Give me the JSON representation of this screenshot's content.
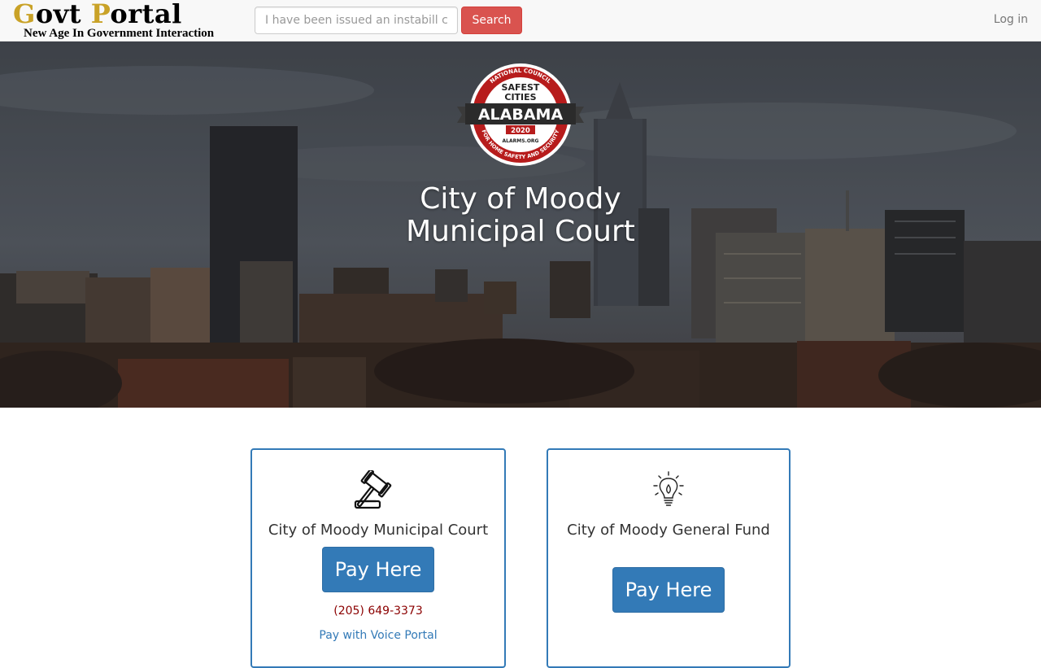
{
  "navbar": {
    "brand_title_first_initial": "G",
    "brand_title_first_rest": "ovt ",
    "brand_title_second_initial": "P",
    "brand_title_second_rest": "ortal",
    "brand_subtitle": "New Age In Government Interaction",
    "search_placeholder": "I have been issued an instabill code",
    "search_button": "Search",
    "login_label": "Log in"
  },
  "hero": {
    "badge": {
      "top_arc": "NATIONAL COUNCIL",
      "line1": "SAFEST",
      "line2": "CITIES",
      "banner": "ALABAMA",
      "year": "2020",
      "site": "ALARMS.ORG",
      "bottom_arc": "FOR HOME SAFETY AND SECURITY"
    },
    "title_line1": "City of Moody",
    "title_line2": "Municipal Court"
  },
  "cards": [
    {
      "icon": "gavel-icon",
      "title": "City of Moody Municipal Court",
      "button": "Pay Here",
      "phone": "(205) 649-3373",
      "voice_link": "Pay with Voice Portal"
    },
    {
      "icon": "lightbulb-icon",
      "title": "City of Moody General Fund",
      "button": "Pay Here"
    }
  ],
  "colors": {
    "brand_gold": "#c9a227",
    "search_red": "#d9534f",
    "primary_blue": "#337ab7",
    "phone_red": "#8b0000"
  }
}
